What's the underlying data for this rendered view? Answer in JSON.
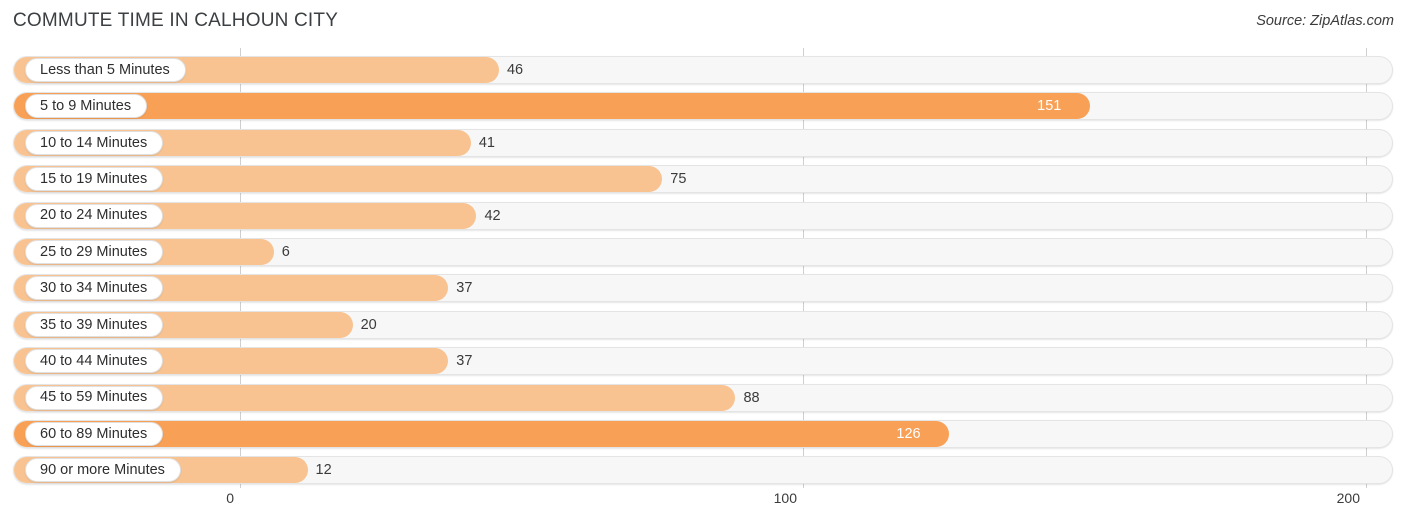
{
  "header": {
    "title": "COMMUTE TIME IN CALHOUN CITY",
    "source": "Source: ZipAtlas.com"
  },
  "colors": {
    "bar_light": "#F8C391",
    "bar_strong": "#F8A055",
    "track": "#F7F7F7",
    "gridline": "#CFCFCF",
    "title_text": "#3C4043",
    "value_text": "#3B3B3B",
    "value_text_inside": "#FFFFFF"
  },
  "chart_data": {
    "type": "bar",
    "orientation": "horizontal",
    "title": "COMMUTE TIME IN CALHOUN CITY",
    "subtitle": "",
    "xlabel": "",
    "ylabel": "",
    "xlim": [
      0,
      200
    ],
    "xticks": [
      0,
      100,
      200
    ],
    "xtick_labels": [
      "0",
      "100",
      "200"
    ],
    "grid": true,
    "legend": "none",
    "categories": [
      "Less than 5 Minutes",
      "5 to 9 Minutes",
      "10 to 14 Minutes",
      "15 to 19 Minutes",
      "20 to 24 Minutes",
      "25 to 29 Minutes",
      "30 to 34 Minutes",
      "35 to 39 Minutes",
      "40 to 44 Minutes",
      "45 to 59 Minutes",
      "60 to 89 Minutes",
      "90 or more Minutes"
    ],
    "values": [
      46,
      151,
      41,
      75,
      42,
      6,
      37,
      20,
      37,
      88,
      126,
      12
    ],
    "value_labels": [
      "46",
      "151",
      "41",
      "75",
      "42",
      "6",
      "37",
      "20",
      "37",
      "88",
      "126",
      "12"
    ]
  }
}
